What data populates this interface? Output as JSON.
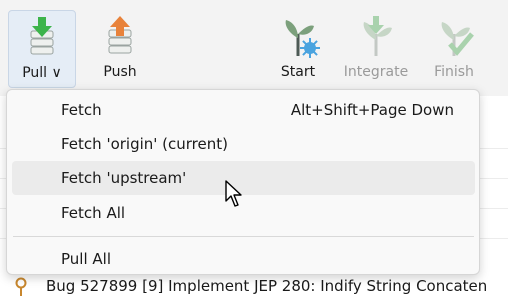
{
  "toolbar": {
    "buttons": [
      {
        "label": "Pull ∨",
        "icon": "pull-icon",
        "state": "active"
      },
      {
        "label": "Push",
        "icon": "push-icon",
        "state": "normal"
      },
      {
        "label": "Start",
        "icon": "start-icon",
        "state": "normal"
      },
      {
        "label": "Integrate",
        "icon": "integrate-icon",
        "state": "disabled"
      },
      {
        "label": "Finish",
        "icon": "finish-icon",
        "state": "disabled"
      }
    ]
  },
  "menu": {
    "items": [
      {
        "label": "Fetch",
        "shortcut": "Alt+Shift+Page Down"
      },
      {
        "label": "Fetch 'origin' (current)"
      },
      {
        "label": "Fetch 'upstream'",
        "hovered": true
      },
      {
        "label": "Fetch All"
      },
      {
        "label": "Pull All"
      }
    ]
  },
  "history": {
    "visible_row": "Bug 527899 [9] Implement JEP 280: Indify String Concaten"
  },
  "colors": {
    "accent_green": "#3cb44b",
    "accent_orange": "#e8823a",
    "menu_bg": "#f9f9f9",
    "hover_bg": "#ebebeb"
  }
}
